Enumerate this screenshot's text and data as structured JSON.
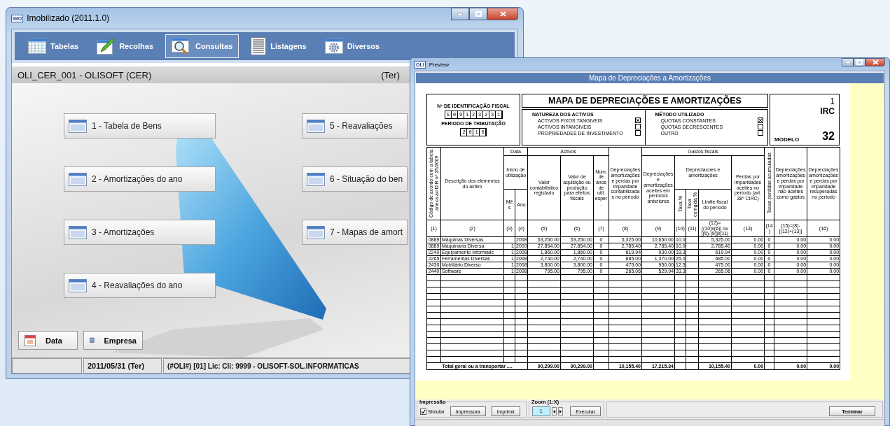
{
  "main_window": {
    "icon_label": "IMO",
    "title": "Imobilizado (2011.1.0)",
    "toolbar": [
      {
        "label": "Tabelas",
        "kind": "grid",
        "selected": false
      },
      {
        "label": "Recolhas",
        "kind": "pencil",
        "selected": false
      },
      {
        "label": "Consultas",
        "kind": "search",
        "selected": true
      },
      {
        "label": "Listagens",
        "kind": "list",
        "selected": false
      },
      {
        "label": "Diversos",
        "kind": "gear",
        "selected": false
      }
    ],
    "company": "OLI_CER_001 - OLISOFT (CER)",
    "day": "(Ter)",
    "menu_left": [
      "1 - Tabela de Bens",
      "2 - Amortizações do ano",
      "3 - Amortizações",
      "4 - Reavaliações do ano"
    ],
    "menu_right": [
      "5 - Reavaliações",
      "6 - Situação do ben",
      "7 - Mapas de amort"
    ],
    "bottom_buttons": [
      {
        "label": "Data",
        "kind": "calendar"
      },
      {
        "label": "Empresa",
        "kind": "database"
      }
    ],
    "status_bar": [
      "2011/05/31 (Ter)",
      "(#OLI#) [01] Lic:  Cli: 9999 - OLISOFT-SOL.INFORMATICAS"
    ]
  },
  "preview_window": {
    "icon_label": "OLI",
    "title": "Preview",
    "heading": "Mapa de Depreciações a Amortizações",
    "form": {
      "nif_label": "Nº DE IDENTIFICAÇÃO FISCAL",
      "nif": "509123231",
      "period_label": "PERIODO DE TRIBUTAÇÃO",
      "period": "2010",
      "title": "MAPA DE DEPRECIAÇÕES E AMORTIZAÇÕES",
      "nature": {
        "heading": "NATUREZA DOS ACTIVOS",
        "options": [
          {
            "label": "ACTIVOS FIXOS TANGIVEIS",
            "checked": true
          },
          {
            "label": "ACTIVOS INTANGIVEIS",
            "checked": false
          },
          {
            "label": "PROPRIEDADES DE INVESTIMENTO",
            "checked": false
          }
        ]
      },
      "method": {
        "heading": "MÉTODO UTILIZADO",
        "options": [
          {
            "label": "QUOTAS CONSTANTES",
            "checked": true
          },
          {
            "label": "QUOTAS DECRESCENTES",
            "checked": false
          },
          {
            "label": "OUTRO",
            "checked": false
          }
        ]
      },
      "page": "1",
      "tax": "IRC",
      "model_label": "MODELO",
      "model": "32"
    },
    "table": {
      "group_headings": [
        "Data",
        "Activos",
        "Gastos fiscais",
        "Início de utilização",
        "Depreciacoes e amortizações"
      ],
      "column_headings": [
        "Código de acordo com a tabela anexa ao D.R nº 25/2009",
        "Descrição dos elementos do activo",
        "Mês",
        "Ano",
        "Valor contabilístico registado",
        "Valor de aquisição ou produção para efeitos fiscais",
        "Num. de anos de util. esper.",
        "Depreciações amortizações e perdas por imparidade contabilizadas no período",
        "Depreciações e amortizações aceites em períodos anteriores",
        "Taxa %",
        "Taxa corrigida %",
        "Limite fiscal do período",
        "Perdas por imparidades aceites no período (art. 38º CIRC)",
        "Taxas perdidas acumuladas",
        "Depreciações amortizações e perdas por imparidade não aceites como gastos",
        "Depreciações amortizações e perdas por imparidade recuperadas no período"
      ],
      "column_numbers": [
        "(1)",
        "(2)",
        "(3)",
        "(4)",
        "(5)",
        "(6)",
        "(7)",
        "(8)",
        "(9)",
        "(10)",
        "(11)",
        "(12)=[(10)x(6)] ou [(6)-(9)]x(11)",
        "(13)",
        "(14)",
        "(15)=(8)-[(12)+(13)]",
        "(16)"
      ],
      "rows": [
        {
          "code": "0889",
          "description": "Máquinas Diversas",
          "year": "2008",
          "book_value": "53,250.00",
          "acquisition_value": "53,250.00",
          "useful_life": "0",
          "recorded": "5,325.00",
          "prior_accepted": "10,650.00",
          "rate": "10.0",
          "limit": "5,325.00",
          "impairment_accepted": "0.00",
          "accumulated_rate": "0",
          "not_accepted": "0.00",
          "recovered": "0.00"
        },
        {
          "code": "0889",
          "description": "Maquinaria Diversa",
          "month": "1",
          "year": "2009",
          "book_value": "27,854.00",
          "acquisition_value": "27,854.00",
          "useful_life": "0",
          "recorded": "2,785.40",
          "prior_accepted": "2,785.40",
          "rate": "10.0",
          "limit": "2,785.40",
          "impairment_accepted": "0.00",
          "accumulated_rate": "0",
          "not_accepted": "0.00",
          "recovered": "0.00"
        },
        {
          "code": "2240",
          "description": "Equipamento Informátic",
          "month": "1",
          "year": "2008",
          "book_value": "1,860.00",
          "acquisition_value": "1,860.00",
          "useful_life": "0",
          "recorded": "619.94",
          "prior_accepted": "930.00",
          "rate": "33.3",
          "limit": "619.94",
          "impairment_accepted": "0.00",
          "accumulated_rate": "0",
          "not_accepted": "0.00",
          "recovered": "0.00"
        },
        {
          "code": "2265",
          "description": "Ferramentas Diversas",
          "month": "1",
          "year": "2008",
          "book_value": "2,740.00",
          "acquisition_value": "2,740.00",
          "useful_life": "0",
          "recorded": "685.00",
          "prior_accepted": "1,370.00",
          "rate": "25.0",
          "limit": "685.00",
          "impairment_accepted": "0.00",
          "accumulated_rate": "0",
          "not_accepted": "0.00",
          "recovered": "0.00"
        },
        {
          "code": "2430",
          "description": "Mobiliário Diverso",
          "month": "1",
          "year": "2008",
          "book_value": "3,800.00",
          "acquisition_value": "3,800.00",
          "useful_life": "0",
          "recorded": "475.00",
          "prior_accepted": "950.00",
          "rate": "12.5",
          "limit": "475.00",
          "impairment_accepted": "0.00",
          "accumulated_rate": "0",
          "not_accepted": "0.00",
          "recovered": "0.00"
        },
        {
          "code": "2440",
          "description": "Software",
          "month": "1",
          "year": "2008",
          "book_value": "795.00",
          "acquisition_value": "795.00",
          "useful_life": "0",
          "recorded": "265.06",
          "prior_accepted": "529.94",
          "rate": "33.3",
          "limit": "265.06",
          "impairment_accepted": "0.00",
          "accumulated_rate": "0",
          "not_accepted": "0.00",
          "recovered": "0.00"
        }
      ],
      "total": {
        "label": "Total geral ou a transportar ....",
        "book_value": "90,299.00",
        "acquisition_value": "90,299.00",
        "recorded": "10,155.40",
        "prior_accepted": "17,215.34",
        "limit": "10,155.40",
        "impairment_accepted": "0.00",
        "not_accepted": "0.00",
        "recovered": "0.00"
      }
    },
    "print_group": {
      "label": "Impressão",
      "simulate": {
        "label": "Simular",
        "checked": true
      },
      "buttons": [
        "Impressora",
        "Imprimir"
      ]
    },
    "zoom_group": {
      "label": "Zoom (1:X)",
      "value": "1",
      "button": "Executar"
    },
    "close_button": "Terminar"
  }
}
